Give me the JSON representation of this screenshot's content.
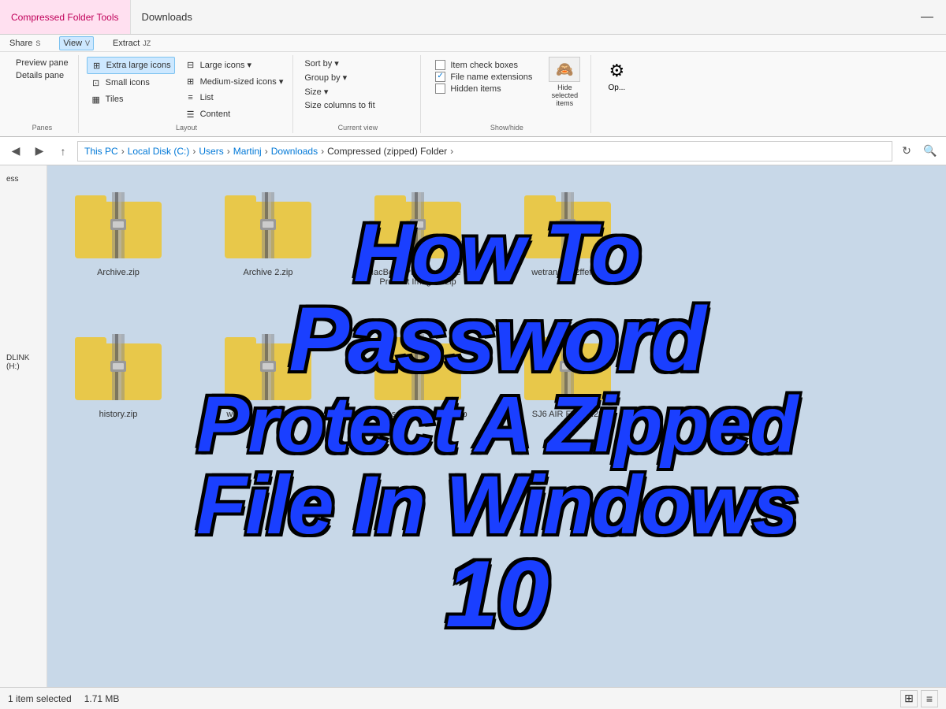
{
  "titlebar": {
    "tab_compressed": "Compressed Folder Tools",
    "tab_downloads": "Downloads",
    "minimize_icon": "—"
  },
  "ribbon": {
    "tabs": [
      "Share",
      "View",
      "Extract"
    ],
    "view_shortcut": "V",
    "extract_shortcut": "JZ",
    "layout_group": {
      "label": "Layout",
      "buttons": [
        {
          "id": "extra-large",
          "label": "Extra large icons",
          "active": true
        },
        {
          "id": "large",
          "label": "Large icons"
        },
        {
          "id": "small",
          "label": "Small icons"
        },
        {
          "id": "tiles",
          "label": "Tiles"
        }
      ],
      "right_buttons": [
        {
          "id": "medium",
          "label": "Medium-sized icons"
        },
        {
          "id": "list",
          "label": "List"
        },
        {
          "id": "content",
          "label": "Content"
        }
      ]
    },
    "current_view_group": {
      "label": "Current view",
      "buttons": [
        {
          "label": "Sort by ▾"
        },
        {
          "label": "Group by ▾"
        },
        {
          "label": "Size ▾"
        },
        {
          "label": "Size columns to fit"
        }
      ]
    },
    "showhide_group": {
      "label": "Show/hide",
      "items": [
        {
          "label": "Item check boxes",
          "checked": false
        },
        {
          "label": "File name extensions",
          "checked": true
        },
        {
          "label": "Hidden items",
          "checked": false
        }
      ],
      "button": "Hide selected items"
    },
    "panes": [
      {
        "label": "Preview pane"
      },
      {
        "label": "Details pane"
      }
    ]
  },
  "address_bar": {
    "path": [
      "This PC",
      "Local Disk (C:)",
      "Users",
      "Martinj",
      "Downloads",
      "Compressed (zipped) Folder"
    ]
  },
  "sidebar": {
    "items": [
      {
        "label": "ess"
      },
      {
        "label": "DLINK (H:)"
      }
    ]
  },
  "files": [
    {
      "name": "Archive.zip",
      "row": 1,
      "col": 1
    },
    {
      "name": "Archive 2.zip",
      "row": 1,
      "col": 2
    },
    {
      "name": "MacBook Pro Showcase & Product Images .zip",
      "row": 1,
      "col": 3
    },
    {
      "name": "wetransfer-2ffef1...",
      "row": 1,
      "col": 4
    },
    {
      "name": "history.zip",
      "row": 2,
      "col": 1
    },
    {
      "name": "wetransfer-bcefb7.zip",
      "row": 2,
      "col": 2
    },
    {
      "name": "spacesniffer_1_3_0_2.zip",
      "row": 2,
      "col": 3
    },
    {
      "name": "SJ6 AIR FW 12.28",
      "row": 2,
      "col": 4
    }
  ],
  "overlay": {
    "line1": "How To",
    "line2": "Password",
    "line3": "Protect A Zipped",
    "line4": "File In Windows",
    "line5": "10"
  },
  "statusbar": {
    "count": "1 item selected",
    "size": "1.71 MB"
  }
}
